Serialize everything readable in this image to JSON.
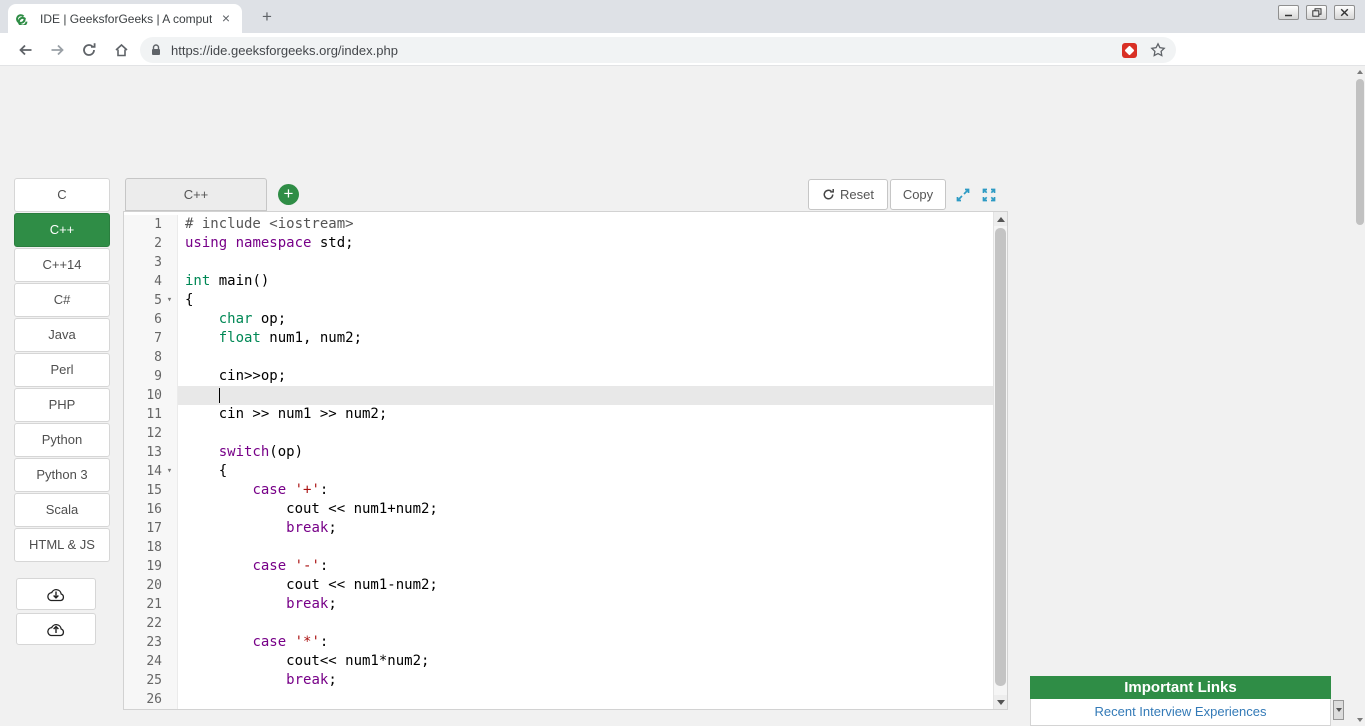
{
  "browser": {
    "tab_title": "IDE | GeeksforGeeks | A compute",
    "url": "https://ide.geeksforgeeks.org/index.php"
  },
  "glyphs": {
    "tab_close": "×",
    "new_tab": "+",
    "add_tab": "+",
    "fold": "▾"
  },
  "sidebar": {
    "selected": "C++",
    "languages": [
      "C",
      "C++",
      "C++14",
      "C#",
      "Java",
      "Perl",
      "PHP",
      "Python",
      "Python 3",
      "Scala",
      "HTML & JS"
    ]
  },
  "editor": {
    "tab": "C++",
    "reset_label": "Reset",
    "copy_label": "Copy",
    "lines": [
      {
        "n": 1,
        "t": [
          [
            "meta",
            "# include <iostream>"
          ]
        ]
      },
      {
        "n": 2,
        "t": [
          [
            "kw",
            "using"
          ],
          [
            "pl",
            " "
          ],
          [
            "kw",
            "namespace"
          ],
          [
            "pl",
            " std;"
          ]
        ]
      },
      {
        "n": 3,
        "t": []
      },
      {
        "n": 4,
        "t": [
          [
            "type",
            "int"
          ],
          [
            "pl",
            " main()"
          ]
        ]
      },
      {
        "n": 5,
        "t": [
          [
            "pl",
            "{"
          ]
        ],
        "fold": true
      },
      {
        "n": 6,
        "t": [
          [
            "pl",
            "    "
          ],
          [
            "type",
            "char"
          ],
          [
            "pl",
            " op;"
          ]
        ]
      },
      {
        "n": 7,
        "t": [
          [
            "pl",
            "    "
          ],
          [
            "type",
            "float"
          ],
          [
            "pl",
            " num1, num2;"
          ]
        ]
      },
      {
        "n": 8,
        "t": []
      },
      {
        "n": 9,
        "t": [
          [
            "pl",
            "    cin>>op;"
          ]
        ]
      },
      {
        "n": 10,
        "t": [
          [
            "pl",
            "    "
          ]
        ],
        "active": true,
        "cursor": true
      },
      {
        "n": 11,
        "t": [
          [
            "pl",
            "    cin >> num1 >> num2;"
          ]
        ]
      },
      {
        "n": 12,
        "t": []
      },
      {
        "n": 13,
        "t": [
          [
            "pl",
            "    "
          ],
          [
            "kw",
            "switch"
          ],
          [
            "pl",
            "(op)"
          ]
        ]
      },
      {
        "n": 14,
        "t": [
          [
            "pl",
            "    {"
          ]
        ],
        "fold": true
      },
      {
        "n": 15,
        "t": [
          [
            "pl",
            "        "
          ],
          [
            "kw",
            "case"
          ],
          [
            "pl",
            " "
          ],
          [
            "str",
            "'+'"
          ],
          [
            "pl",
            ":"
          ]
        ]
      },
      {
        "n": 16,
        "t": [
          [
            "pl",
            "            cout << num1+num2;"
          ]
        ]
      },
      {
        "n": 17,
        "t": [
          [
            "pl",
            "            "
          ],
          [
            "kw",
            "break"
          ],
          [
            "pl",
            ";"
          ]
        ]
      },
      {
        "n": 18,
        "t": []
      },
      {
        "n": 19,
        "t": [
          [
            "pl",
            "        "
          ],
          [
            "kw",
            "case"
          ],
          [
            "pl",
            " "
          ],
          [
            "str",
            "'-'"
          ],
          [
            "pl",
            ":"
          ]
        ]
      },
      {
        "n": 20,
        "t": [
          [
            "pl",
            "            cout << num1-num2;"
          ]
        ]
      },
      {
        "n": 21,
        "t": [
          [
            "pl",
            "            "
          ],
          [
            "kw",
            "break"
          ],
          [
            "pl",
            ";"
          ]
        ]
      },
      {
        "n": 22,
        "t": []
      },
      {
        "n": 23,
        "t": [
          [
            "pl",
            "        "
          ],
          [
            "kw",
            "case"
          ],
          [
            "pl",
            " "
          ],
          [
            "str",
            "'*'"
          ],
          [
            "pl",
            ":"
          ]
        ]
      },
      {
        "n": 24,
        "t": [
          [
            "pl",
            "            cout<< num1*num2;"
          ]
        ]
      },
      {
        "n": 25,
        "t": [
          [
            "pl",
            "            "
          ],
          [
            "kw",
            "break"
          ],
          [
            "pl",
            ";"
          ]
        ]
      },
      {
        "n": 26,
        "t": []
      }
    ]
  },
  "links": {
    "title": "Important Links",
    "items": [
      "Recent Interview Experiences"
    ]
  },
  "colors": {
    "brand_green": "#2f8d46",
    "expand_icon_blue": "#2e9bc4",
    "link_blue": "#337ab7",
    "active_line_bg": "#e8e8e8",
    "code": {
      "keyword": "#770088",
      "type": "#008855",
      "string": "#aa1111",
      "meta": "#555555",
      "plain": "#000000"
    }
  }
}
